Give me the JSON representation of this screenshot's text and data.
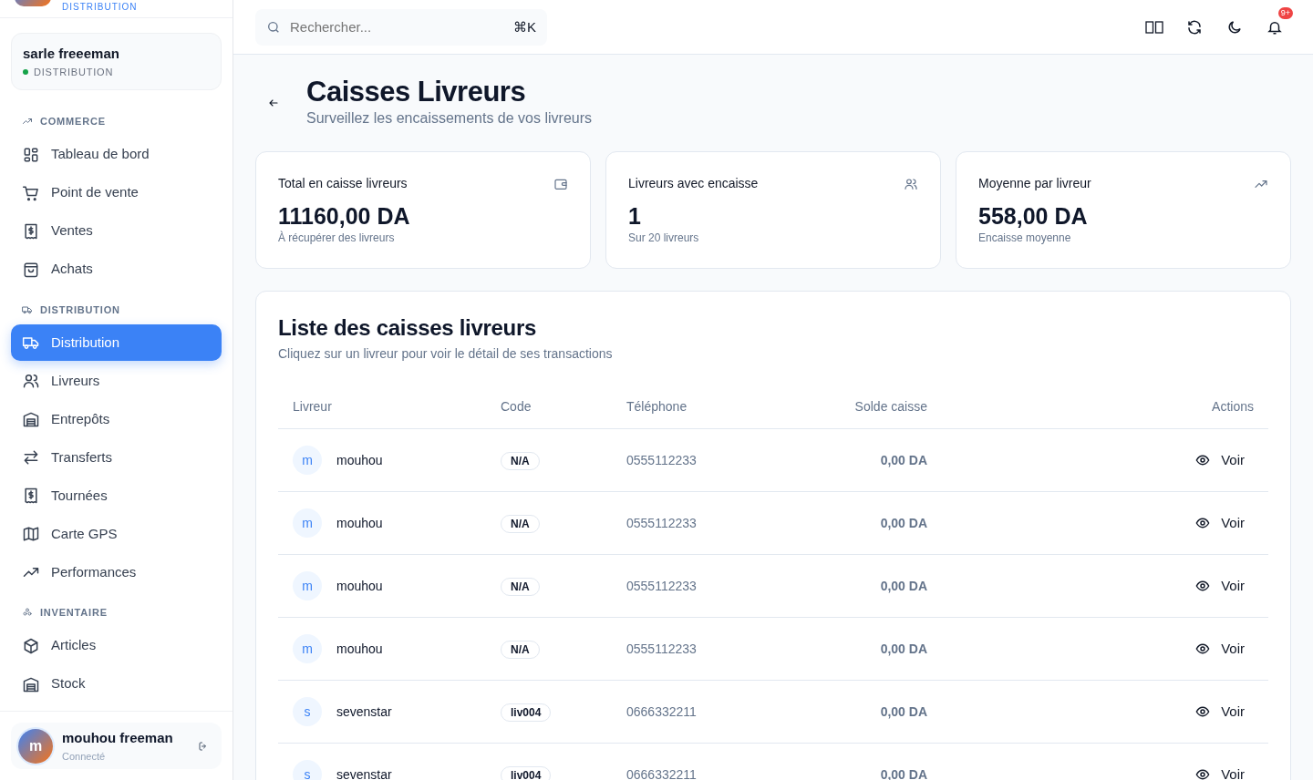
{
  "brand": {
    "subtitle": "DISTRIBUTION"
  },
  "company": {
    "name": "sarle freeeman",
    "status": "DISTRIBUTION",
    "online": true
  },
  "sidebar": {
    "sections": [
      {
        "title": "COMMERCE",
        "items": [
          {
            "label": "Tableau de bord",
            "selected": false
          },
          {
            "label": "Point de vente",
            "selected": false
          },
          {
            "label": "Ventes",
            "selected": false
          },
          {
            "label": "Achats",
            "selected": false
          }
        ]
      },
      {
        "title": "DISTRIBUTION",
        "items": [
          {
            "label": "Distribution",
            "selected": true
          },
          {
            "label": "Livreurs",
            "selected": false
          },
          {
            "label": "Entrepôts",
            "selected": false
          },
          {
            "label": "Transferts",
            "selected": false
          },
          {
            "label": "Tournées",
            "selected": false
          },
          {
            "label": "Carte GPS",
            "selected": false
          },
          {
            "label": "Performances",
            "selected": false
          }
        ]
      },
      {
        "title": "INVENTAIRE",
        "items": [
          {
            "label": "Articles",
            "selected": false
          },
          {
            "label": "Stock",
            "selected": false
          }
        ]
      }
    ]
  },
  "user": {
    "initial": "m",
    "name": "mouhou freeman",
    "status": "Connecté"
  },
  "search": {
    "placeholder": "Rechercher...",
    "shortcut": "⌘K"
  },
  "notifications": {
    "badge": "9+"
  },
  "page": {
    "title": "Caisses Livreurs",
    "subtitle": "Surveillez les encaissements de vos livreurs"
  },
  "stats": [
    {
      "label": "Total en caisse livreurs",
      "value": "11160,00 DA",
      "note": "À récupérer des livreurs"
    },
    {
      "label": "Livreurs avec encaisse",
      "value": "1",
      "note": "Sur 20 livreurs"
    },
    {
      "label": "Moyenne par livreur",
      "value": "558,00 DA",
      "note": "Encaisse moyenne"
    }
  ],
  "table": {
    "title": "Liste des caisses livreurs",
    "subtitle": "Cliquez sur un livreur pour voir le détail de ses transactions",
    "columns": [
      "Livreur",
      "Code",
      "Téléphone",
      "Solde caisse",
      "Actions"
    ],
    "rows": [
      {
        "initial": "m",
        "name": "mouhou",
        "code": "N/A",
        "phone": "0555112233",
        "balance": "0,00 DA",
        "action": "Voir"
      },
      {
        "initial": "m",
        "name": "mouhou",
        "code": "N/A",
        "phone": "0555112233",
        "balance": "0,00 DA",
        "action": "Voir"
      },
      {
        "initial": "m",
        "name": "mouhou",
        "code": "N/A",
        "phone": "0555112233",
        "balance": "0,00 DA",
        "action": "Voir"
      },
      {
        "initial": "m",
        "name": "mouhou",
        "code": "N/A",
        "phone": "0555112233",
        "balance": "0,00 DA",
        "action": "Voir"
      },
      {
        "initial": "s",
        "name": "sevenstar",
        "code": "liv004",
        "phone": "0666332211",
        "balance": "0,00 DA",
        "action": "Voir"
      },
      {
        "initial": "s",
        "name": "sevenstar",
        "code": "liv004",
        "phone": "0666332211",
        "balance": "0,00 DA",
        "action": "Voir"
      }
    ]
  }
}
